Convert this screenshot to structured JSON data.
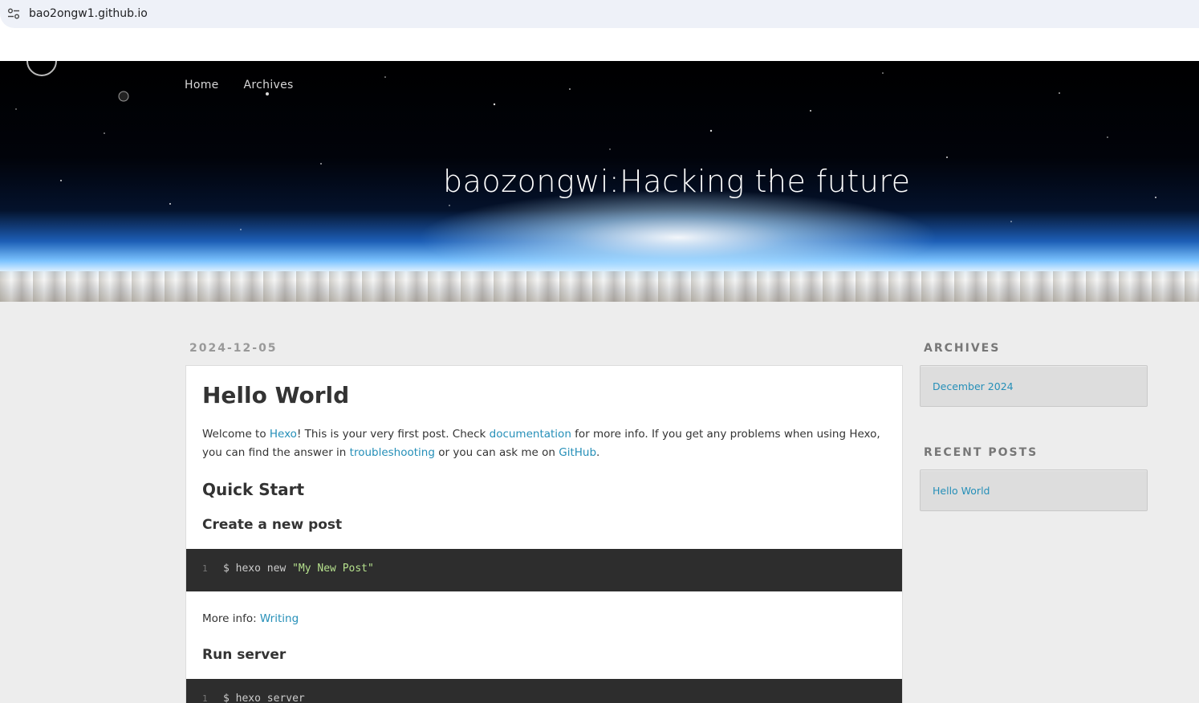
{
  "browser": {
    "url": "bao2ongw1.github.io",
    "site_info_icon": "tune-icon"
  },
  "header": {
    "nav": [
      {
        "label": "Home"
      },
      {
        "label": "Archives"
      }
    ],
    "title": "baozongwi:Hacking the future"
  },
  "article": {
    "date": "2024-12-05",
    "title": "Hello World",
    "intro": {
      "t1": "Welcome to ",
      "link_hexo": "Hexo",
      "t2": "! This is your very first post. Check ",
      "link_docs": "documentation",
      "t3": " for more info. If you get any problems when using Hexo, you can find the answer in ",
      "link_trouble": "troubleshooting",
      "t4": " or you can ask me on ",
      "link_github": "GitHub",
      "t5": "."
    },
    "quick_start": "Quick Start",
    "create_post": "Create a new post",
    "code1": {
      "line": "1",
      "cmd": "$ hexo new ",
      "arg": "\"My New Post\""
    },
    "more_info_label": "More info: ",
    "more_info_link": "Writing",
    "run_server": "Run server",
    "code2": {
      "line": "1",
      "cmd": "$ hexo server"
    }
  },
  "sidebar": {
    "archives_title": "ARCHIVES",
    "archives_item": "December 2024",
    "recent_title": "RECENT POSTS",
    "recent_item": "Hello World"
  },
  "colors": {
    "link": "#258fb8",
    "code_bg": "#2d2d2d",
    "page_bg": "#ededed"
  }
}
